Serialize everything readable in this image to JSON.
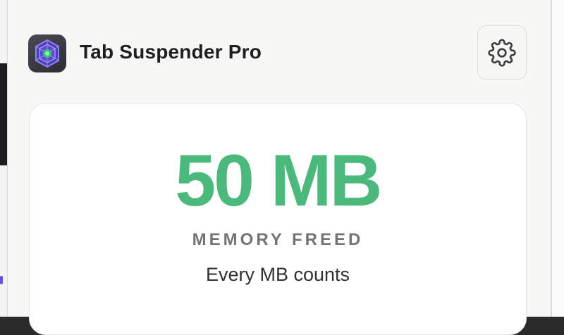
{
  "app": {
    "title": "Tab Suspender Pro",
    "logo_icon": "hexagon-gem-icon",
    "logo_colors": {
      "outer": "#7a6cf0",
      "inner": "#3fc57b",
      "bg": "#35353c"
    }
  },
  "header": {
    "settings_icon": "gear-icon"
  },
  "stats": {
    "memory_value": "50 MB",
    "memory_label": "MEMORY FREED",
    "caption": "Every MB counts"
  },
  "colors": {
    "accent_green": "#4cb97c",
    "label_gray": "#737478",
    "card_bg": "#ffffff",
    "panel_bg": "#f7f7f6"
  }
}
